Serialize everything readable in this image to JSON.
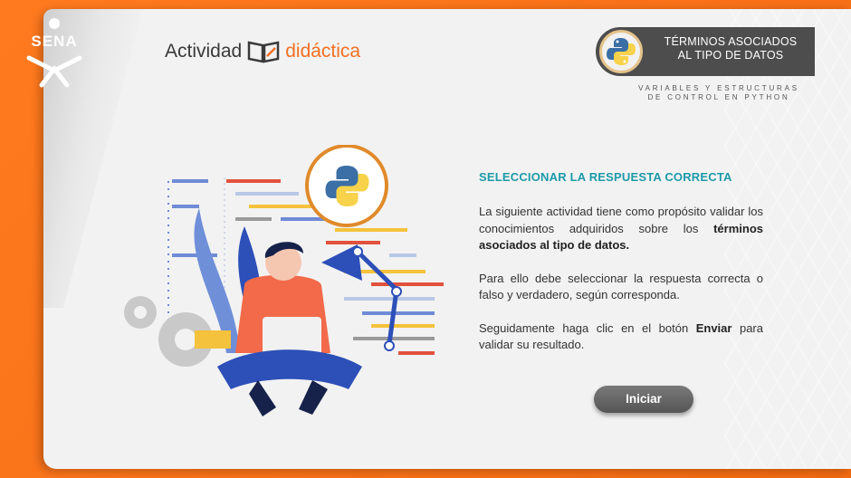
{
  "colors": {
    "frame": "#f26f21",
    "accent_teal": "#1d9aa9",
    "badge_bg": "#4d4d4d",
    "python_blue": "#3b6fa6",
    "python_yellow": "#f7d24a"
  },
  "logo": {
    "text": "SENA"
  },
  "brand": {
    "part1": "Actividad",
    "part2": "didáctica",
    "icon": "book-icon"
  },
  "badge": {
    "title_line1": "TÉRMINOS ASOCIADOS",
    "title_line2": "AL TIPO DE DATOS",
    "icon": "python-logo-icon",
    "subtitle_line1": "VARIABLES Y ESTRUCTURAS",
    "subtitle_line2": "DE CONTROL EN PYTHON"
  },
  "content": {
    "heading": "SELECCIONAR LA RESPUESTA CORRECTA",
    "p1_text": "La siguiente actividad tiene como propósito validar los conocimientos adquiridos sobre los ",
    "p1_bold": "términos asociados al tipo de datos.",
    "p2": "Para ello debe seleccionar la respuesta correcta o falso y verdadero, según corresponda.",
    "p3_text": "Seguidamente haga clic en el botón ",
    "p3_bold": "Enviar",
    "p3_end": " para validar su resultado."
  },
  "start_button": {
    "label": "Iniciar"
  }
}
